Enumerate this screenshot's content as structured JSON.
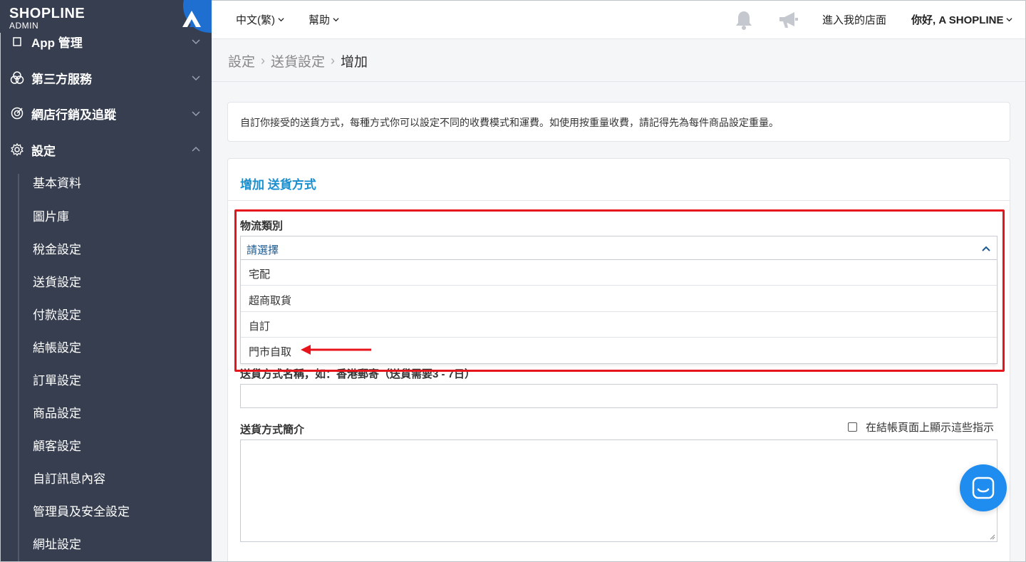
{
  "brand": {
    "logo": "SHOPLINE",
    "sub": "ADMIN"
  },
  "sidebar": {
    "items": [
      {
        "label": "App 管理",
        "icon": "app-icon"
      },
      {
        "label": "第三方服務",
        "icon": "third-party-icon"
      },
      {
        "label": "網店行銷及追蹤",
        "icon": "marketing-icon"
      },
      {
        "label": "設定",
        "icon": "gear-icon"
      }
    ],
    "sub_items": [
      "基本資料",
      "圖片庫",
      "稅金設定",
      "送貨設定",
      "付款設定",
      "結帳設定",
      "訂單設定",
      "商品設定",
      "顧客設定",
      "自訂訊息內容",
      "管理員及安全設定",
      "網址設定"
    ]
  },
  "header": {
    "language": "中文(繁)",
    "help": "幫助",
    "store_link": "進入我的店面",
    "greeting": "你好, A SHOPLINE"
  },
  "breadcrumb": {
    "level1": "設定",
    "level2": "送貨設定",
    "current": "增加"
  },
  "info": {
    "text": "自訂你接受的送貨方式，每種方式你可以設定不同的收費模式和運費。如使用按重量收費，請記得先為每件商品設定重量。"
  },
  "form": {
    "title": "增加 送貨方式",
    "logistics_label": "物流類別",
    "logistics_value": "請選擇",
    "options": [
      "宅配",
      "超商取貨",
      "自訂",
      "門市自取"
    ],
    "name_label": "送貨方式名稱，如：香港郵寄（送貨需要3 - 7日）",
    "desc_label": "送貨方式簡介",
    "show_instructions_label": "在結帳頁面上顯示這些指示"
  },
  "colors": {
    "sidebar_bg": "#363e4f",
    "accent": "#1a8fcf",
    "highlight": "#e8141b",
    "chat": "#1f8cf0"
  }
}
